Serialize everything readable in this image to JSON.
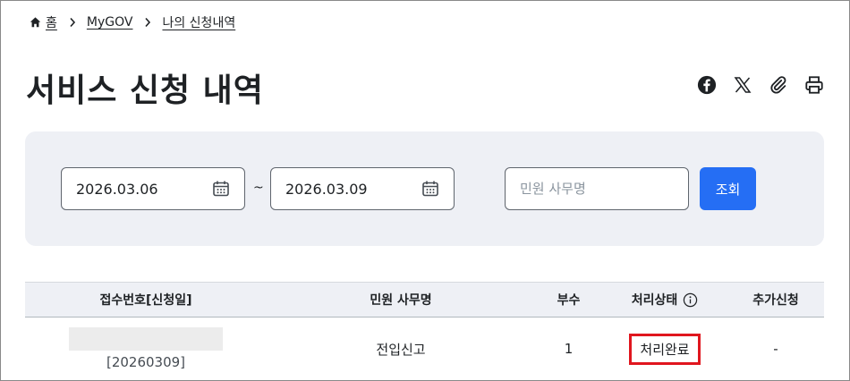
{
  "breadcrumb": {
    "home": "홈",
    "mygov": "MyGOV",
    "current": "나의 신청내역"
  },
  "page": {
    "title": "서비스 신청 내역"
  },
  "share": [
    "facebook-icon",
    "x-icon",
    "link-icon",
    "print-icon"
  ],
  "search": {
    "start_date": "2026.03.06",
    "separator": "~",
    "end_date": "2026.03.09",
    "keyword_placeholder": "민원 사무명",
    "button_label": "조회"
  },
  "table": {
    "headers": [
      "접수번호[신청일]",
      "민원 사무명",
      "부수",
      "처리상태",
      "추가신청"
    ],
    "rows": [
      {
        "receipt_date": "[20260309]",
        "service_name": "전입신고",
        "copies": "1",
        "status": "처리완료",
        "additional": "-"
      }
    ]
  },
  "colors": {
    "primary": "#256ef4",
    "panel_bg": "#eef0f5",
    "highlight": "#e0161e",
    "text": "#1e2124"
  }
}
